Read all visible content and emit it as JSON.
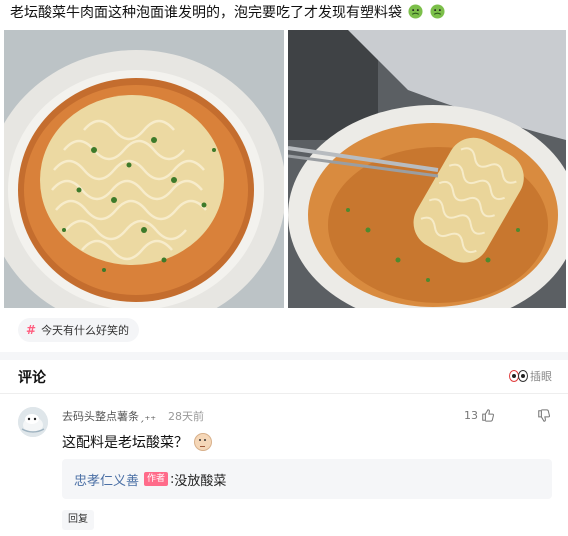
{
  "post": {
    "text": "老坛酸菜牛肉面这种泡面谁发明的，泡完要吃了才发现有塑料袋",
    "emojis": [
      "nauseated-face-icon",
      "nauseated-face-icon"
    ],
    "images": [
      "noodle-bowl-photo",
      "noodle-packet-photo"
    ]
  },
  "topic": {
    "hash": "#",
    "label": "今天有什么好笑的"
  },
  "comments": {
    "title": "评论",
    "insert_eye_label": "插眼",
    "items": [
      {
        "username": "去码头整点薯条ˏ₊₊",
        "time": "28天前",
        "likes": "13",
        "text": "这配料是老坛酸菜？",
        "reply": {
          "author": "忠孝仁义善",
          "badge": "作者",
          "colon": ":",
          "text": "没放酸菜"
        },
        "reply_button": "回复"
      }
    ]
  },
  "colors": {
    "accent_pink": "#ff5d7f",
    "link_blue": "#4a6fa5"
  }
}
